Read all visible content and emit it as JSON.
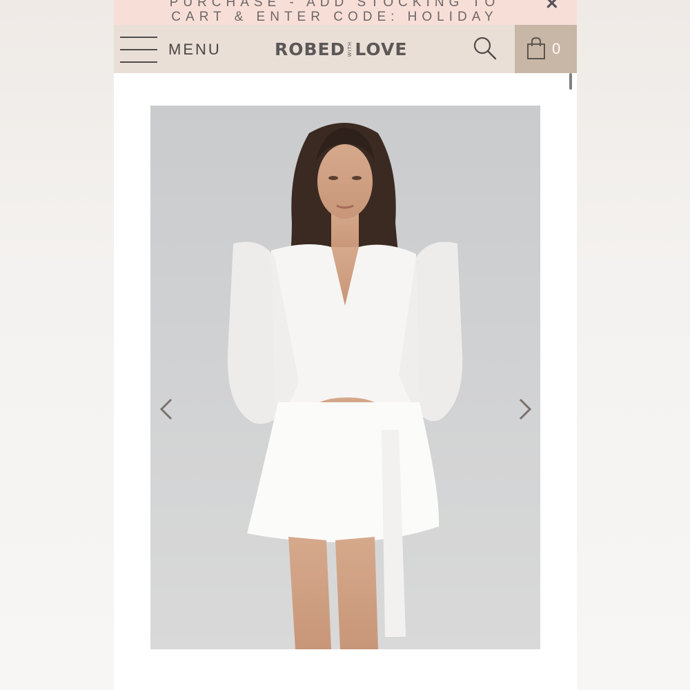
{
  "promo": {
    "line1": "PURCHASE - ADD STOCKING TO",
    "line2": "CART & ENTER CODE: HOLIDAY",
    "close_glyph": "✕",
    "background": "#f7dfd8"
  },
  "header": {
    "menu_label": "MENU",
    "logo_left": "ROBED",
    "logo_middle": "WITH",
    "logo_right": "LOVE",
    "cart_count": "0",
    "background": "#e9dfd6",
    "cart_background": "#c8b7a6"
  },
  "icons": {
    "menu": "hamburger-icon",
    "search": "search-icon",
    "cart": "shopping-bag-icon",
    "prev": "chevron-left-icon",
    "next": "chevron-right-icon",
    "close": "close-icon"
  },
  "product_image": {
    "subject": "model-in-white-sheer-robe"
  }
}
